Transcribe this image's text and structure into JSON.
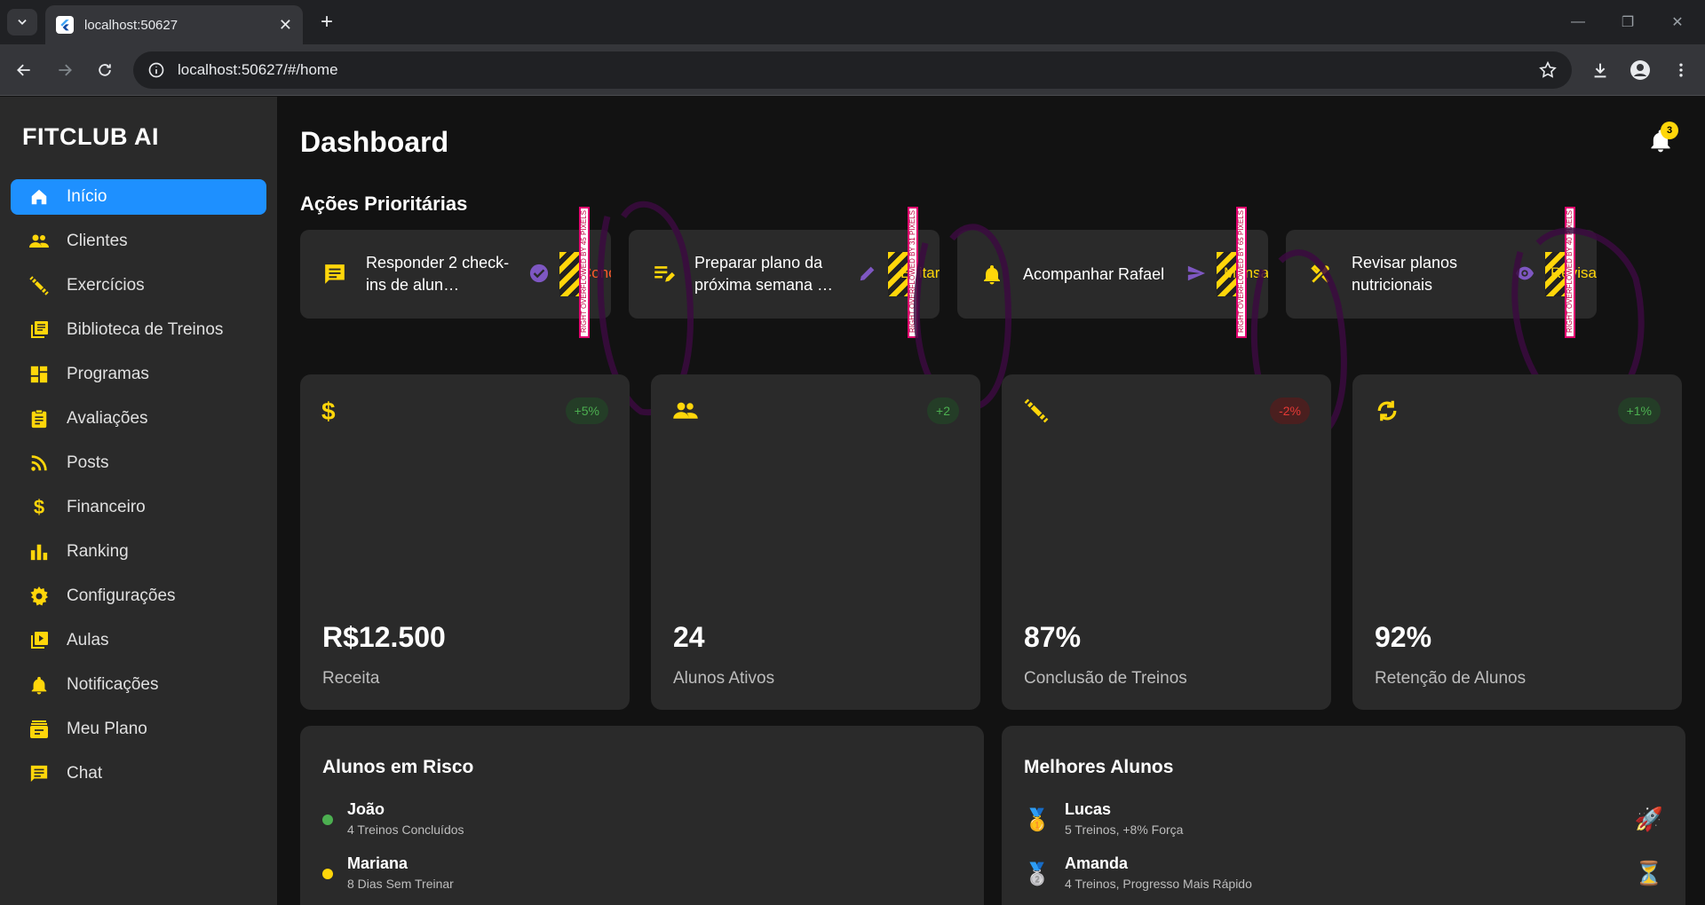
{
  "browser": {
    "tab_title": "localhost:50627",
    "url": "localhost:50627/#/home"
  },
  "app": {
    "brand": "FITCLUB AI",
    "page_title": "Dashboard",
    "notification_count": "3",
    "accent": "#1e90ff",
    "icon_color": "#ffd60a"
  },
  "sidebar": {
    "items": [
      {
        "label": "Início",
        "icon": "home-icon",
        "active": true
      },
      {
        "label": "Clientes",
        "icon": "people-icon"
      },
      {
        "label": "Exercícios",
        "icon": "dumbbell-icon"
      },
      {
        "label": "Biblioteca de Treinos",
        "icon": "library-icon"
      },
      {
        "label": "Programas",
        "icon": "dashboard-icon"
      },
      {
        "label": "Avaliações",
        "icon": "assignment-icon"
      },
      {
        "label": "Posts",
        "icon": "rss-icon"
      },
      {
        "label": "Financeiro",
        "icon": "dollar-icon"
      },
      {
        "label": "Ranking",
        "icon": "bar-chart-icon"
      },
      {
        "label": "Configurações",
        "icon": "gear-icon"
      },
      {
        "label": "Aulas",
        "icon": "video-library-icon"
      },
      {
        "label": "Notificações",
        "icon": "bell-icon"
      },
      {
        "label": "Meu Plano",
        "icon": "plan-icon"
      },
      {
        "label": "Chat",
        "icon": "chat-icon"
      }
    ]
  },
  "priority": {
    "title": "Ações Prioritárias",
    "cards": [
      {
        "text": "Responder 2 check-ins de alun…",
        "icon": "chat-icon",
        "action_icon": "check-circle-icon",
        "action_label": "Concluir",
        "overflow": "RIGHT OVERFLOWED BY 45 PIXELS"
      },
      {
        "text": "Preparar plano da próxima semana …",
        "icon": "edit-note-icon",
        "action_icon": "pencil-icon",
        "action_label": "Editar",
        "overflow": "RIGHT OVERFLOWED BY 31 PIXELS"
      },
      {
        "text": "Acompanhar Rafael",
        "icon": "bell-icon",
        "action_icon": "send-icon",
        "action_label": "Mensagem",
        "overflow": "RIGHT OVERFLOWED BY 65 PIXELS"
      },
      {
        "text": "Revisar planos nutricionais",
        "icon": "restaurant-icon",
        "action_icon": "eye-icon",
        "action_label": "Revisar",
        "overflow": "RIGHT OVERFLOWED BY 40 PIXELS"
      }
    ]
  },
  "stats": [
    {
      "value": "R$12.500",
      "label": "Receita",
      "delta": "+5%",
      "positive": true,
      "icon": "dollar-icon"
    },
    {
      "value": "24",
      "label": "Alunos Ativos",
      "delta": "+2",
      "positive": true,
      "icon": "people-icon"
    },
    {
      "value": "87%",
      "label": "Conclusão de Treinos",
      "delta": "-2%",
      "positive": false,
      "icon": "dumbbell-icon"
    },
    {
      "value": "92%",
      "label": "Retenção de Alunos",
      "delta": "+1%",
      "positive": true,
      "icon": "refresh-icon"
    }
  ],
  "at_risk": {
    "title": "Alunos em Risco",
    "rows": [
      {
        "name": "João",
        "detail": "4 Treinos Concluídos",
        "status_color": "#4caf50"
      },
      {
        "name": "Mariana",
        "detail": "8 Dias Sem Treinar",
        "status_color": "#ffd60a"
      }
    ]
  },
  "top": {
    "title": "Melhores Alunos",
    "rows": [
      {
        "name": "Lucas",
        "detail": "5 Treinos, +8% Força",
        "medal": "🥇",
        "badge": "🚀"
      },
      {
        "name": "Amanda",
        "detail": "4 Treinos, Progresso Mais Rápido",
        "medal": "🥈",
        "badge": "⏳"
      }
    ]
  }
}
